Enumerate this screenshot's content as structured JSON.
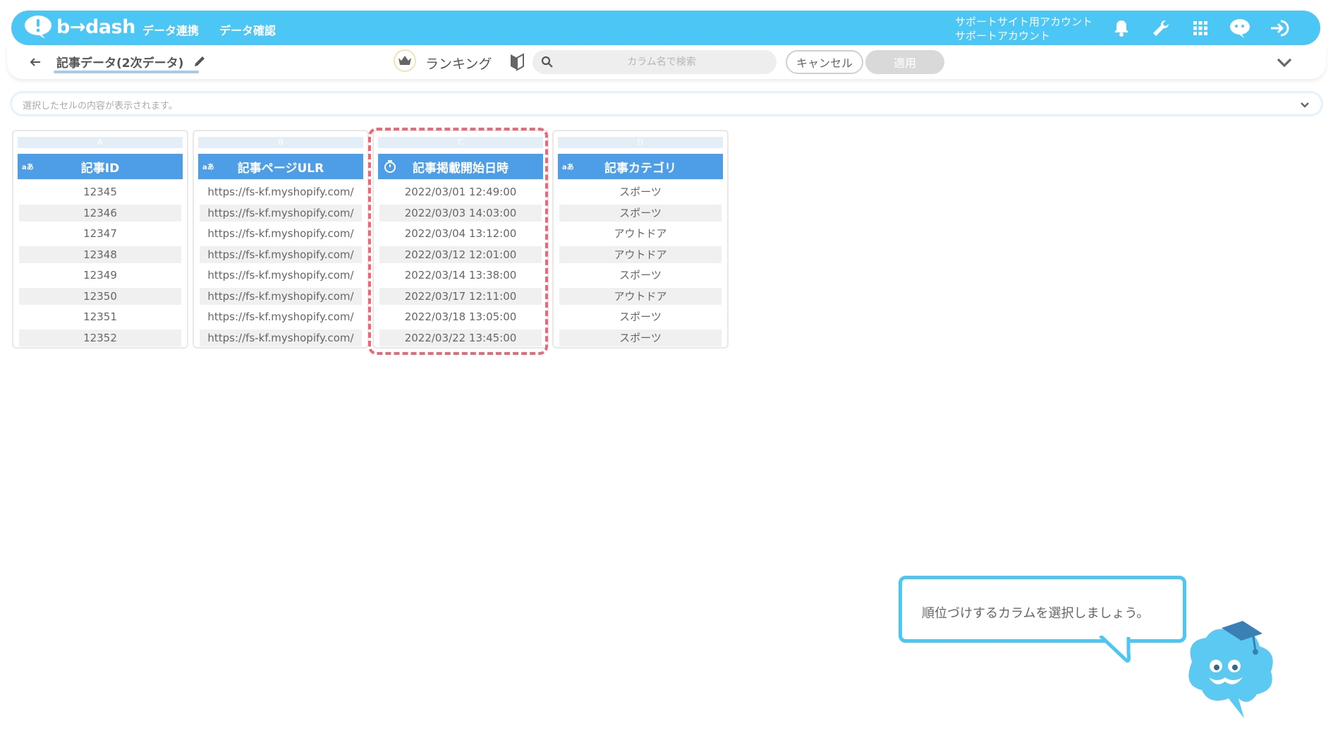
{
  "header": {
    "logo_text": "b→dash",
    "nav": [
      "データ連携",
      "データ確認"
    ],
    "account_line1": "サポートサイト用アカウント",
    "account_line2": "サポートアカウント",
    "icons": [
      "bell-icon",
      "wrench-icon",
      "apps-grid-icon",
      "support-chat-icon",
      "logout-icon"
    ]
  },
  "subheader": {
    "page_title": "記事データ(2次データ)",
    "ranking_label": "ランキング",
    "search_placeholder": "カラム名で検索",
    "cancel_label": "キャンセル",
    "apply_label": "適用"
  },
  "cell_bar": {
    "placeholder": "選択したセルの内容が表示されます。"
  },
  "table": {
    "columns": [
      {
        "letter": "A",
        "type": "aあ",
        "name": "記事ID",
        "values": [
          "12345",
          "12346",
          "12347",
          "12348",
          "12349",
          "12350",
          "12351",
          "12352"
        ]
      },
      {
        "letter": "B",
        "type": "aあ",
        "name": "記事ページULR",
        "values": [
          "https://fs-kf.myshopify.com/",
          "https://fs-kf.myshopify.com/",
          "https://fs-kf.myshopify.com/",
          "https://fs-kf.myshopify.com/",
          "https://fs-kf.myshopify.com/",
          "https://fs-kf.myshopify.com/",
          "https://fs-kf.myshopify.com/",
          "https://fs-kf.myshopify.com/"
        ]
      },
      {
        "letter": "C",
        "type": "clock",
        "name": "記事掲載開始日時",
        "values": [
          "2022/03/01 12:49:00",
          "2022/03/03 14:03:00",
          "2022/03/04 13:12:00",
          "2022/03/12 12:01:00",
          "2022/03/14 13:38:00",
          "2022/03/17 12:11:00",
          "2022/03/18 13:05:00",
          "2022/03/22 13:45:00"
        ]
      },
      {
        "letter": "D",
        "type": "aあ",
        "name": "記事カテゴリ",
        "values": [
          "スポーツ",
          "スポーツ",
          "アウトドア",
          "アウトドア",
          "スポーツ",
          "アウトドア",
          "スポーツ",
          "スポーツ"
        ]
      }
    ]
  },
  "tooltip": {
    "text": "順位づけするカラムを選択しましょう。"
  },
  "colors": {
    "brand": "#4cc6f4",
    "column_header": "#4d9ee6",
    "highlight": "#ef6776"
  }
}
